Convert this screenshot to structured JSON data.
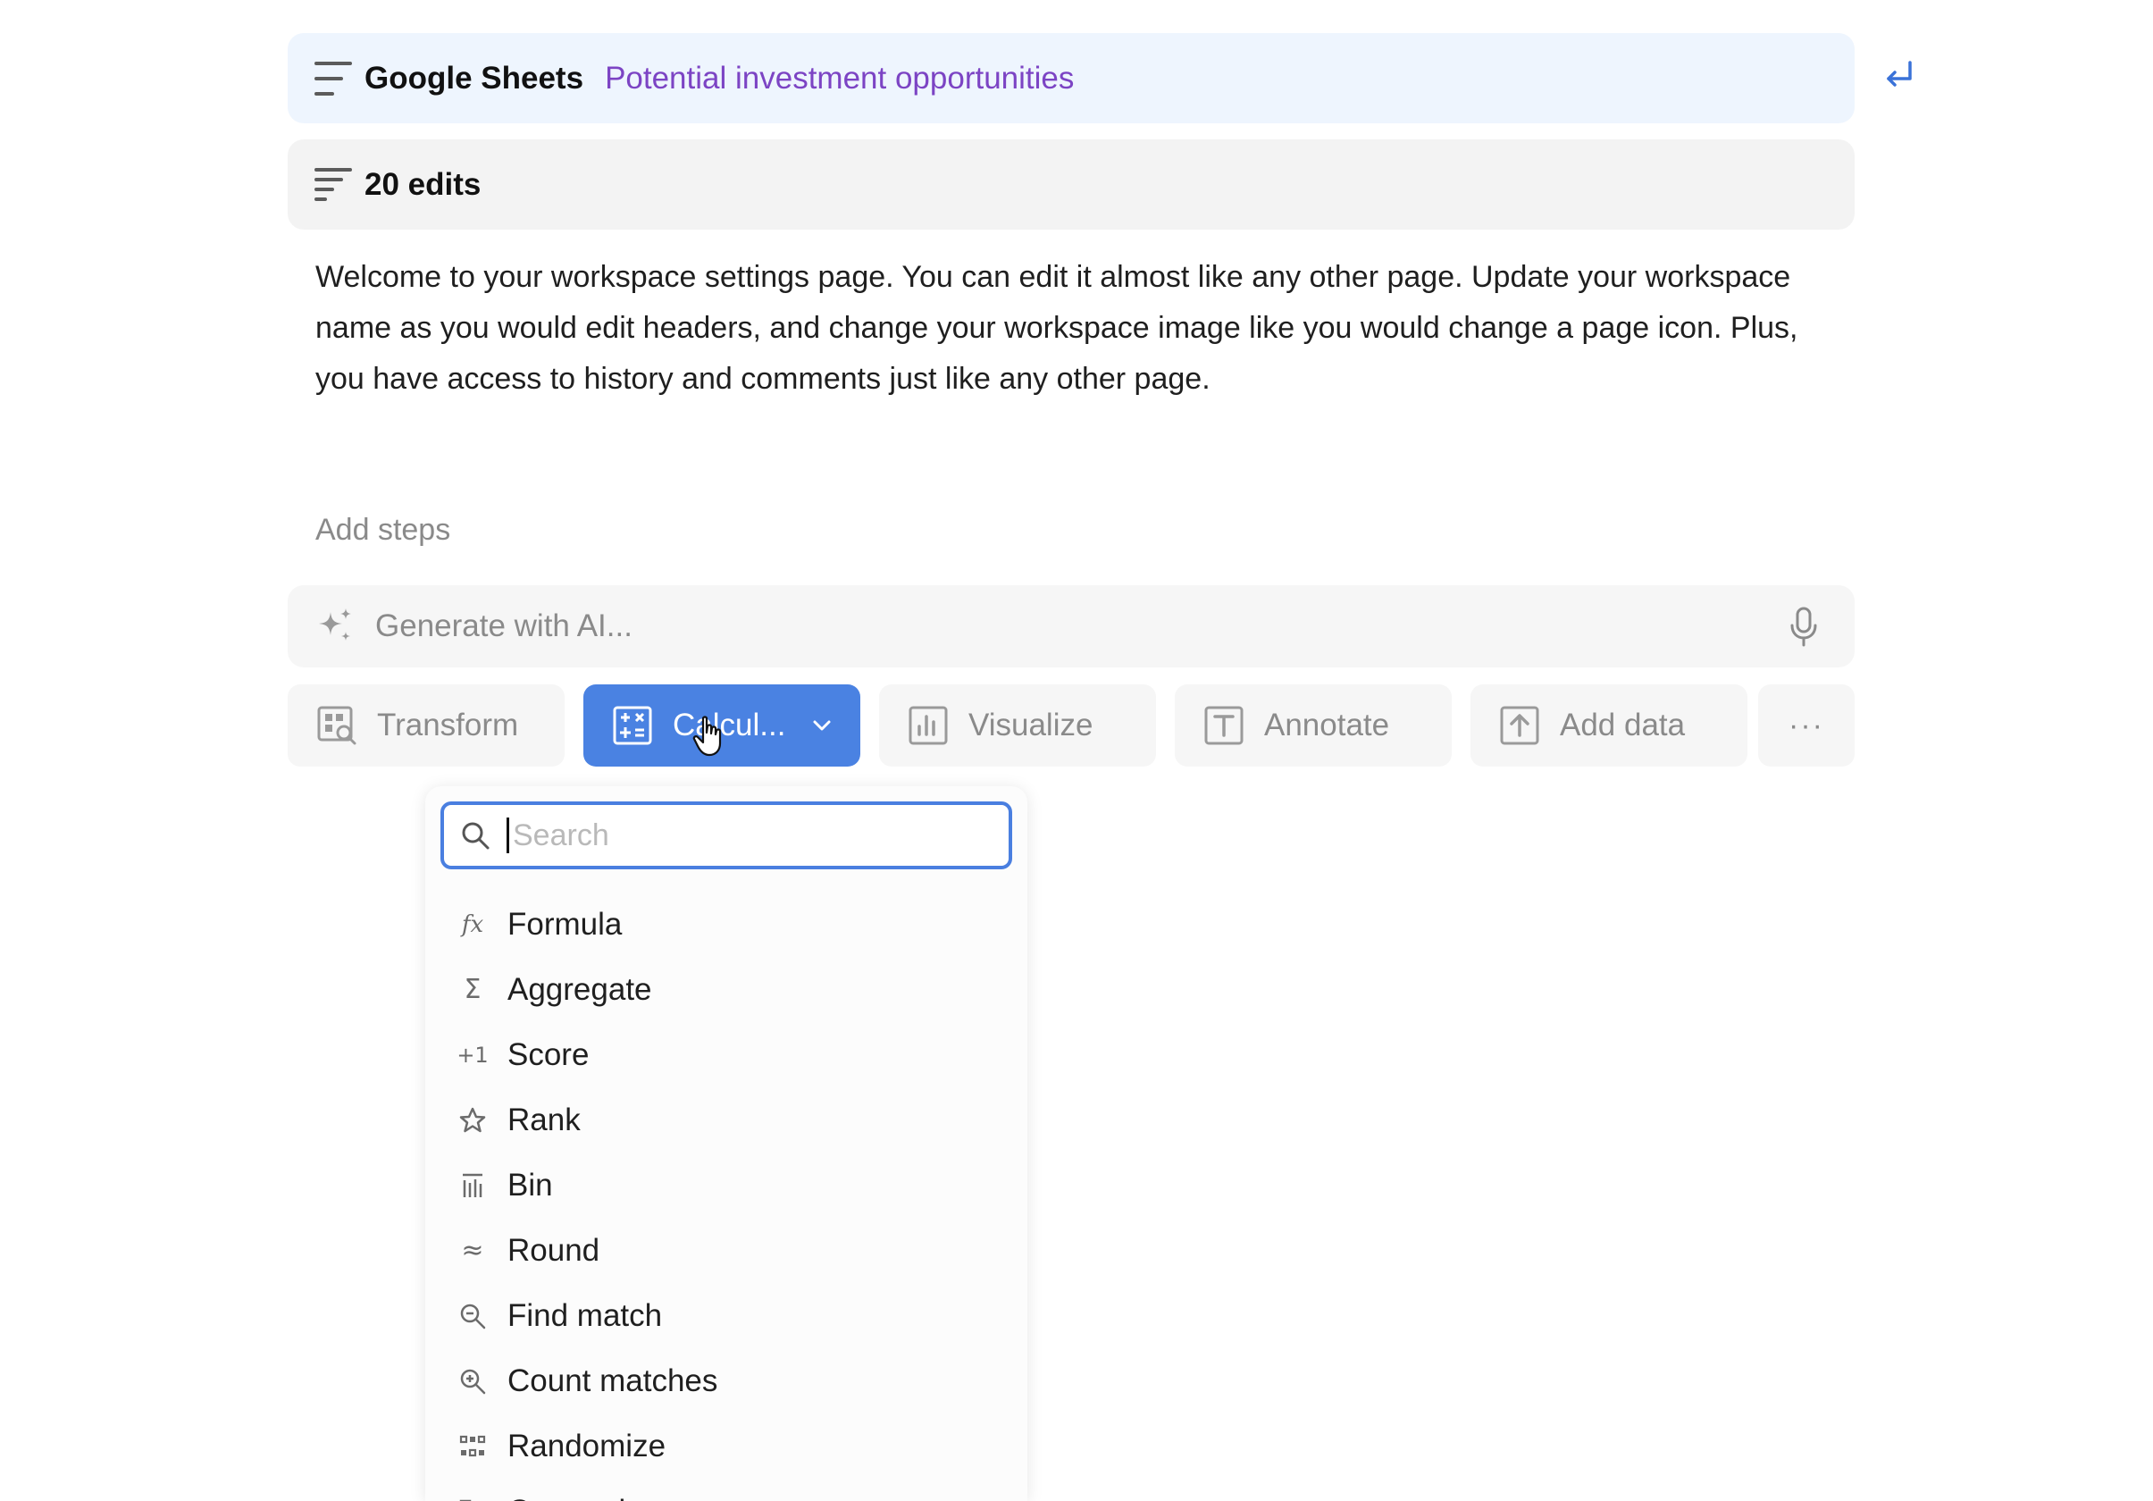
{
  "source_bar": {
    "app": "Google Sheets",
    "sheet": "Potential investment opportunities"
  },
  "edits_bar": {
    "label": "20 edits"
  },
  "description": "Welcome to your workspace settings page. You can edit it almost like any other page. Update your workspace name as you would edit headers, and change your workspace image like you would change a page icon. Plus, you have access to history and comments just like any other page.",
  "add_steps": "Add steps",
  "ai": {
    "placeholder": "Generate with AI..."
  },
  "toolbar": {
    "transform": "Transform",
    "calculate": "Calcul...",
    "visualize": "Visualize",
    "annotate": "Annotate",
    "add_data": "Add data",
    "more": "···"
  },
  "dropdown": {
    "search_placeholder": "Search",
    "items": [
      "Formula",
      "Aggregate",
      "Score",
      "Rank",
      "Bin",
      "Round",
      "Find match",
      "Count matches",
      "Randomize",
      "Categorize"
    ]
  },
  "colors": {
    "accent": "#4a82e2",
    "sheet_name": "#7c44c4",
    "source_bg": "#eef5fe"
  }
}
